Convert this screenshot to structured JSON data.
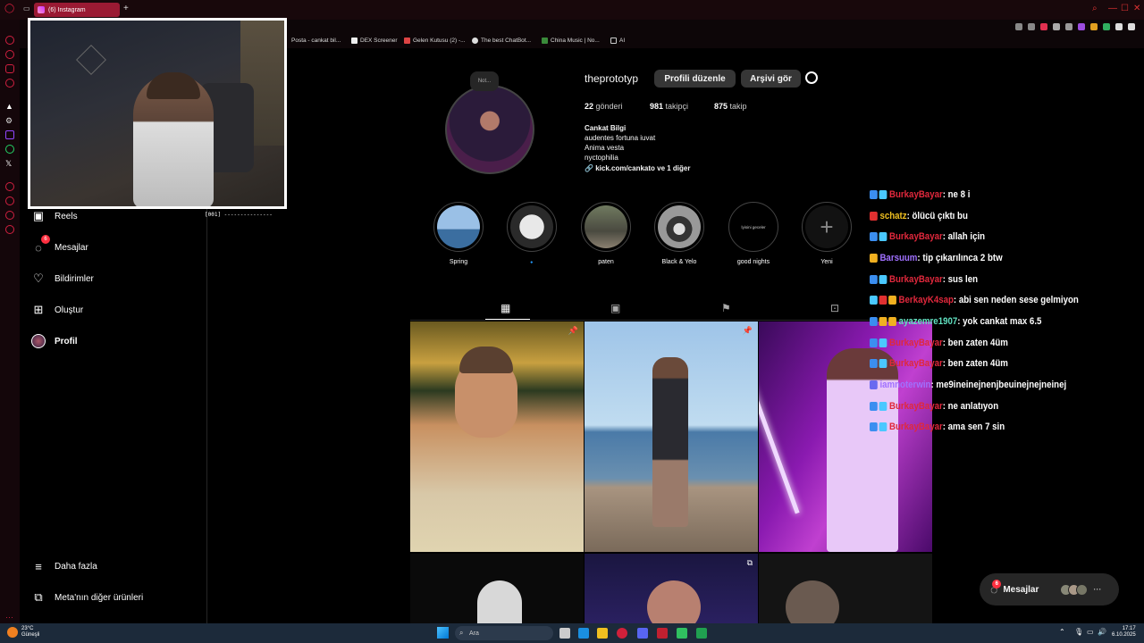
{
  "browser": {
    "tab_title": "(6) Instagram",
    "new_tab": "+",
    "bookmarks": [
      "Posta - cankat bil...",
      "DEX Screener",
      "Gelen Kutusu (2) -...",
      "The best ChatBot...",
      "China Music | No...",
      "AI"
    ]
  },
  "nav": {
    "items": [
      {
        "label": "Reels",
        "icon": "reels-icon"
      },
      {
        "label": "Mesajlar",
        "icon": "messenger-icon",
        "badge": "6"
      },
      {
        "label": "Bildirimler",
        "icon": "heart-icon"
      },
      {
        "label": "Oluştur",
        "icon": "plus-square-icon"
      },
      {
        "label": "Profil",
        "icon": "avatar"
      }
    ],
    "more": "Daha fazla",
    "meta": "Meta'nın diğer ürünleri"
  },
  "webcam": {
    "counter": "[001]"
  },
  "profile": {
    "note": "Not...",
    "username": "theprototyp",
    "edit_button": "Profili düzenle",
    "archive_button": "Arşivi gör",
    "posts_count": "22",
    "posts_label": "gönderi",
    "followers_count": "981",
    "followers_label": "takipçi",
    "following_count": "875",
    "following_label": "takip",
    "name": "Cankat Bilgi",
    "bio_lines": [
      "audentes fortuna iuvat",
      "Anima vesta",
      "nyctophilia"
    ],
    "link": "kick.com/cankato ve 1 diğer"
  },
  "highlights": [
    {
      "label": "Spring"
    },
    {
      "label": "🔹"
    },
    {
      "label": "paten"
    },
    {
      "label": "Black & Yelo"
    },
    {
      "label": "good nights",
      "inner": "İyisini geceler"
    },
    {
      "label": "Yeni"
    }
  ],
  "chat": [
    {
      "user": "BurkayBayar",
      "msg": ": ne 8 i",
      "color": "#e0283c",
      "icons": [
        "#3b8ef0",
        "#4ac8ff"
      ]
    },
    {
      "user": "schatz",
      "msg": ": ölücü çıktı bu",
      "color": "#f0c020",
      "icons": [
        "#e03030"
      ]
    },
    {
      "user": "BurkayBayar",
      "msg": ": allah için",
      "color": "#e0283c",
      "icons": [
        "#3b8ef0",
        "#4ac8ff"
      ]
    },
    {
      "user": "Barsuum",
      "msg": ": tip çıkarılınca 2 btw",
      "color": "#a070ff",
      "icons": [
        "#f0b020"
      ]
    },
    {
      "user": "BurkayBayar",
      "msg": ": sus len",
      "color": "#e0283c",
      "icons": [
        "#3b8ef0",
        "#4ac8ff"
      ]
    },
    {
      "user": "BerkayK4sap",
      "msg": ": abi sen neden sese gelmiyon",
      "color": "#e0283c",
      "icons": [
        "#4ac8ff",
        "#e03030",
        "#f0b020"
      ]
    },
    {
      "user": "ayazemre1907",
      "msg": ": yok cankat max 6.5",
      "color": "#60e0c0",
      "icons": [
        "#3b8ef0",
        "#f0b020",
        "#f0b020"
      ]
    },
    {
      "user": "BurkayBayar",
      "msg": ": ben zaten 4üm",
      "color": "#e0283c",
      "icons": [
        "#3b8ef0",
        "#4ac8ff"
      ]
    },
    {
      "user": "BurkayBayar",
      "msg": ": ben zaten 4üm",
      "color": "#e0283c",
      "icons": [
        "#3b8ef0",
        "#4ac8ff"
      ]
    },
    {
      "user": "iamnoterwin",
      "msg": ": me9ineinejnenjbeuinejnejneinej",
      "color": "#a070ff",
      "icons": [
        "#6a6af0"
      ]
    },
    {
      "user": "BurkayBayar",
      "msg": ": ne anlatıyon",
      "color": "#e0283c",
      "icons": [
        "#3b8ef0",
        "#4ac8ff"
      ]
    },
    {
      "user": "BurkayBayar",
      "msg": ": ama sen 7 sin",
      "color": "#e0283c",
      "icons": [
        "#3b8ef0",
        "#4ac8ff"
      ]
    }
  ],
  "messages_pill": {
    "label": "Mesajlar",
    "badge": "6"
  },
  "taskbar": {
    "weather_temp": "23°C",
    "weather_desc": "Güneşli",
    "search_placeholder": "Ara",
    "time": "17:17",
    "date": "6.10.2025"
  }
}
